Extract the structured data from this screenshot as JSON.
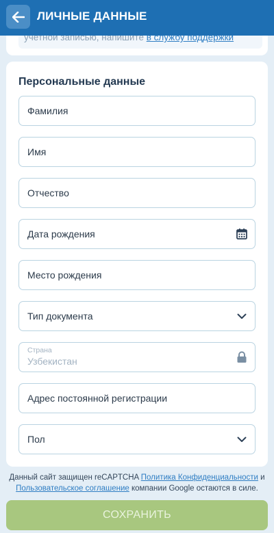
{
  "header": {
    "title": "ЛИЧНЫЕ ДАННЫЕ",
    "bg_color": "#1e6fb3"
  },
  "notice": {
    "text": "учетной записью, напишите ",
    "link": "в службу поддержки"
  },
  "form": {
    "section_title": "Персональные данные",
    "fields": {
      "last_name": "Фамилия",
      "first_name": "Имя",
      "patronymic": "Отчество",
      "birth_date": "Дата рождения",
      "birth_place": "Место рождения",
      "document_type": "Тип документа",
      "country_label": "Страна",
      "country_value": "Узбекистан",
      "address": "Адрес постоянной регистрации",
      "gender": "Пол"
    }
  },
  "recaptcha": {
    "text_1": "Данный сайт защищен reCAPTCHA ",
    "privacy_link": "Политика Конфиденциальности",
    "text_2": " и ",
    "terms_link": "Пользовательское соглашение",
    "text_3": " компании Google остаются в силе."
  },
  "save_button": {
    "label": "СОХРАНИТЬ",
    "color": "#a8c77f"
  },
  "icons": {
    "back": "arrow-left-icon",
    "calendar": "calendar-icon",
    "dropdown": "chevron-down-icon",
    "lock": "lock-icon"
  }
}
